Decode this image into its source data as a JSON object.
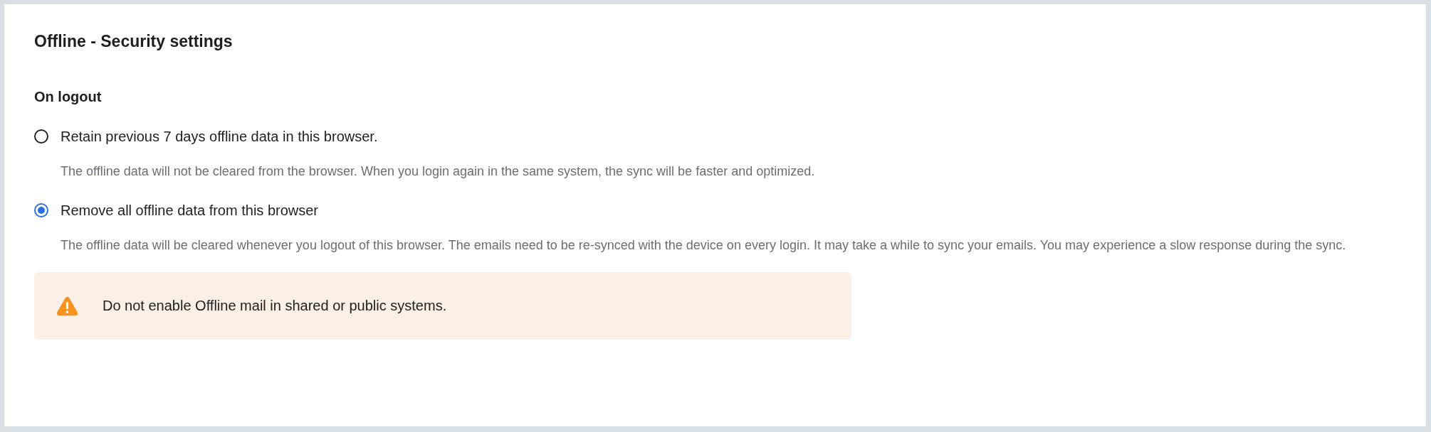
{
  "title": "Offline - Security settings",
  "section": "On logout",
  "options": [
    {
      "label": "Retain previous 7 days offline data in this browser.",
      "description": "The offline data will not be cleared from the browser. When you login again in the same system, the sync will be faster and optimized.",
      "selected": false
    },
    {
      "label": "Remove all offline data from this browser",
      "description": "The offline data will be cleared whenever you logout of this browser. The emails need to be re-synced with the device on every login. It may take a while to sync your emails. You may experience a slow response during the sync.",
      "selected": true
    }
  ],
  "warning": {
    "kind": "warning",
    "text": "Do not enable Offline mail in shared or public systems."
  }
}
